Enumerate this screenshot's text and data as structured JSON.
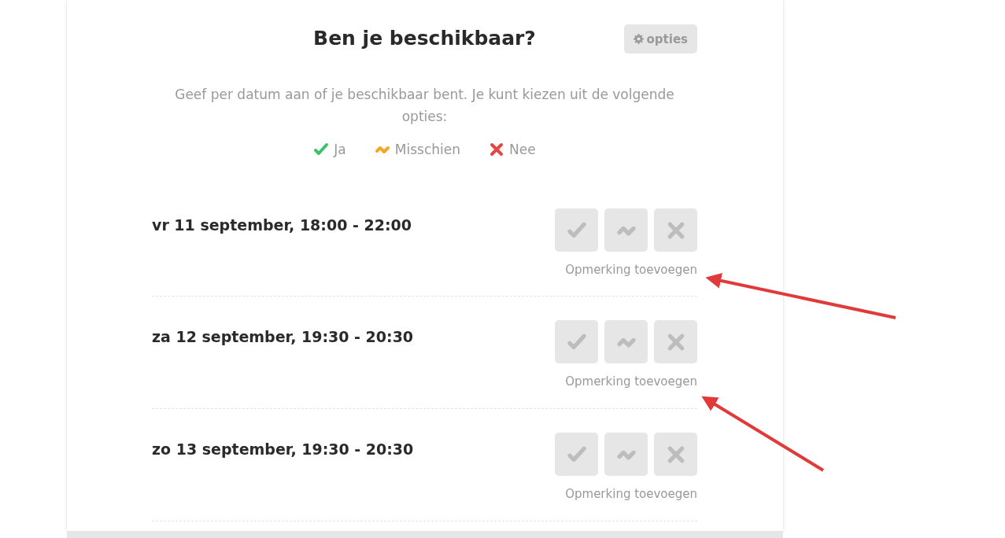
{
  "header": {
    "title": "Ben je beschikbaar?",
    "options_button": "opties"
  },
  "intro": "Geef per datum aan of je beschikbaar bent. Je kunt kiezen uit de volgende opties:",
  "legend": [
    {
      "kind": "yes",
      "label": "Ja"
    },
    {
      "kind": "maybe",
      "label": "Misschien"
    },
    {
      "kind": "no",
      "label": "Nee"
    }
  ],
  "dates": [
    {
      "label": "vr 11 september, 18:00 - 22:00",
      "choices": [
        {
          "kind": "yes",
          "selected": false
        },
        {
          "kind": "maybe",
          "selected": false
        },
        {
          "kind": "no",
          "selected": false
        }
      ],
      "comment_link": "Opmerking toevoegen"
    },
    {
      "label": "za 12 september, 19:30 - 20:30",
      "choices": [
        {
          "kind": "yes",
          "selected": false
        },
        {
          "kind": "maybe",
          "selected": false
        },
        {
          "kind": "no",
          "selected": false
        }
      ],
      "comment_link": "Opmerking toevoegen"
    },
    {
      "label": "zo 13 september, 19:30 - 20:30",
      "choices": [
        {
          "kind": "yes",
          "selected": false
        },
        {
          "kind": "maybe",
          "selected": false
        },
        {
          "kind": "no",
          "selected": false
        }
      ],
      "comment_link": "Opmerking toevoegen"
    }
  ]
}
